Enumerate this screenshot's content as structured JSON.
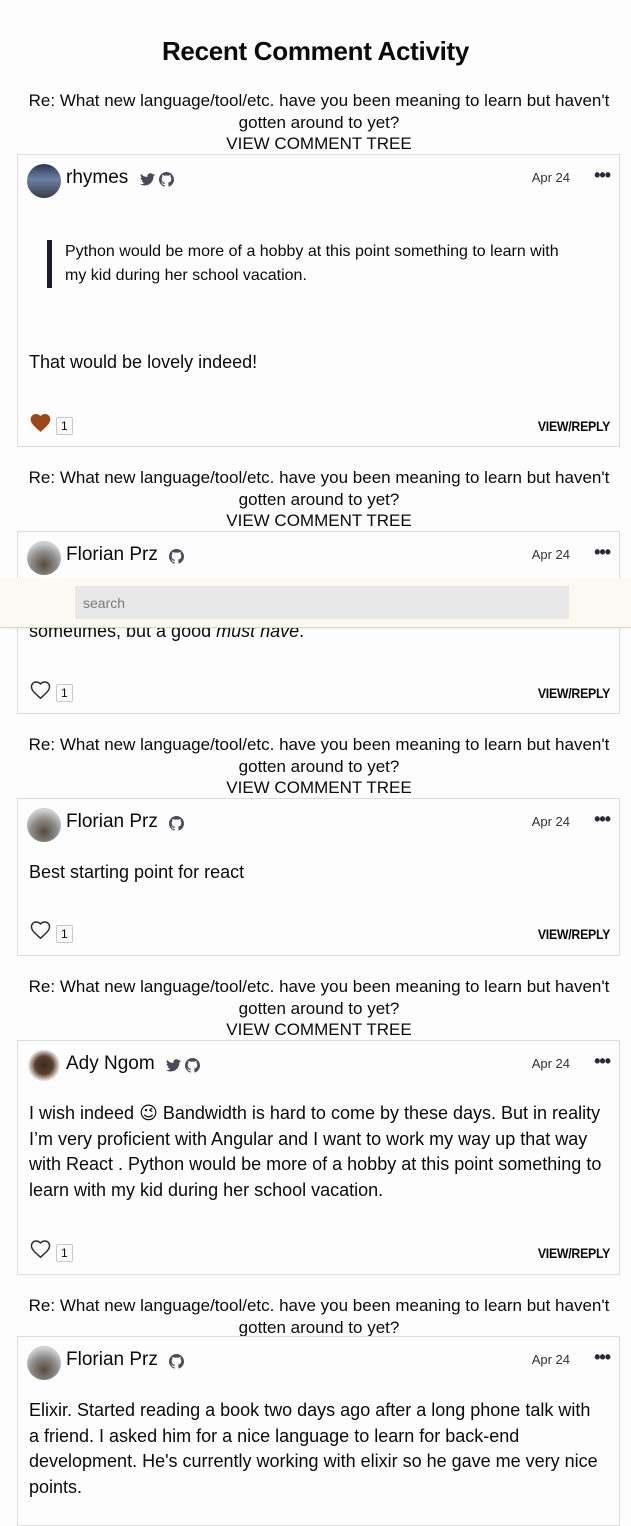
{
  "page": {
    "title": "Recent Comment Activity"
  },
  "search": {
    "placeholder": "search"
  },
  "entries": [
    {
      "thread_title": "Re: What new language/tool/etc. have you been meaning to learn but haven't gotten around to yet?",
      "tree_link": "VIEW COMMENT TREE",
      "author": "rhymes",
      "social": [
        "twitter-icon",
        "github-icon"
      ],
      "date": "Apr 24",
      "menu": "•••",
      "quote": "Python would be more of a hobby at this point something to learn with my kid during her school vacation.",
      "body": "That would be lovely indeed!",
      "liked": true,
      "likes": "1",
      "view_reply": "VIEW/REPLY"
    },
    {
      "thread_title": "Re: What new language/tool/etc. have you been meaning to learn but haven't gotten around to yet?",
      "tree_link": "VIEW COMMENT TREE",
      "author": "Florian Prz",
      "social": [
        "github-icon"
      ],
      "date": "Apr 24",
      "menu": "•••",
      "body_partial_prefix": "sometimes, but a good ",
      "body_partial_em": "must have",
      "body_partial_suffix": ".",
      "liked": false,
      "likes": "1",
      "view_reply": "VIEW/REPLY"
    },
    {
      "thread_title": "Re: What new language/tool/etc. have you been meaning to learn but haven't gotten around to yet?",
      "tree_link": "VIEW COMMENT TREE",
      "author": "Florian Prz",
      "social": [
        "github-icon"
      ],
      "date": "Apr 24",
      "menu": "•••",
      "body": "Best starting point for react",
      "liked": false,
      "likes": "1",
      "view_reply": "VIEW/REPLY"
    },
    {
      "thread_title": "Re: What new language/tool/etc. have you been meaning to learn but haven't gotten around to yet?",
      "tree_link": "VIEW COMMENT TREE",
      "author": "Ady Ngom",
      "social": [
        "twitter-icon",
        "github-icon"
      ],
      "date": "Apr 24",
      "menu": "•••",
      "body_before_emoji": "I wish indeed ",
      "emoji": "😉",
      "body_after_emoji": " Bandwidth is hard to come by these days. But in reality I’m very proficient with Angular and I want to work my way up that way with React . Python would be more of a hobby at this point something to learn with my kid during her school vacation.",
      "liked": false,
      "likes": "1",
      "view_reply": "VIEW/REPLY"
    },
    {
      "thread_title": "Re: What new language/tool/etc. have you been meaning to learn but haven't gotten around to yet?",
      "author": "Florian Prz",
      "social": [
        "github-icon"
      ],
      "date": "Apr 24",
      "menu": "•••",
      "body": "Elixir. Started reading a book two days ago after a long phone talk with a friend. I asked him for a nice language to learn for back-end development. He's currently working with elixir so he gave me very nice points."
    }
  ]
}
